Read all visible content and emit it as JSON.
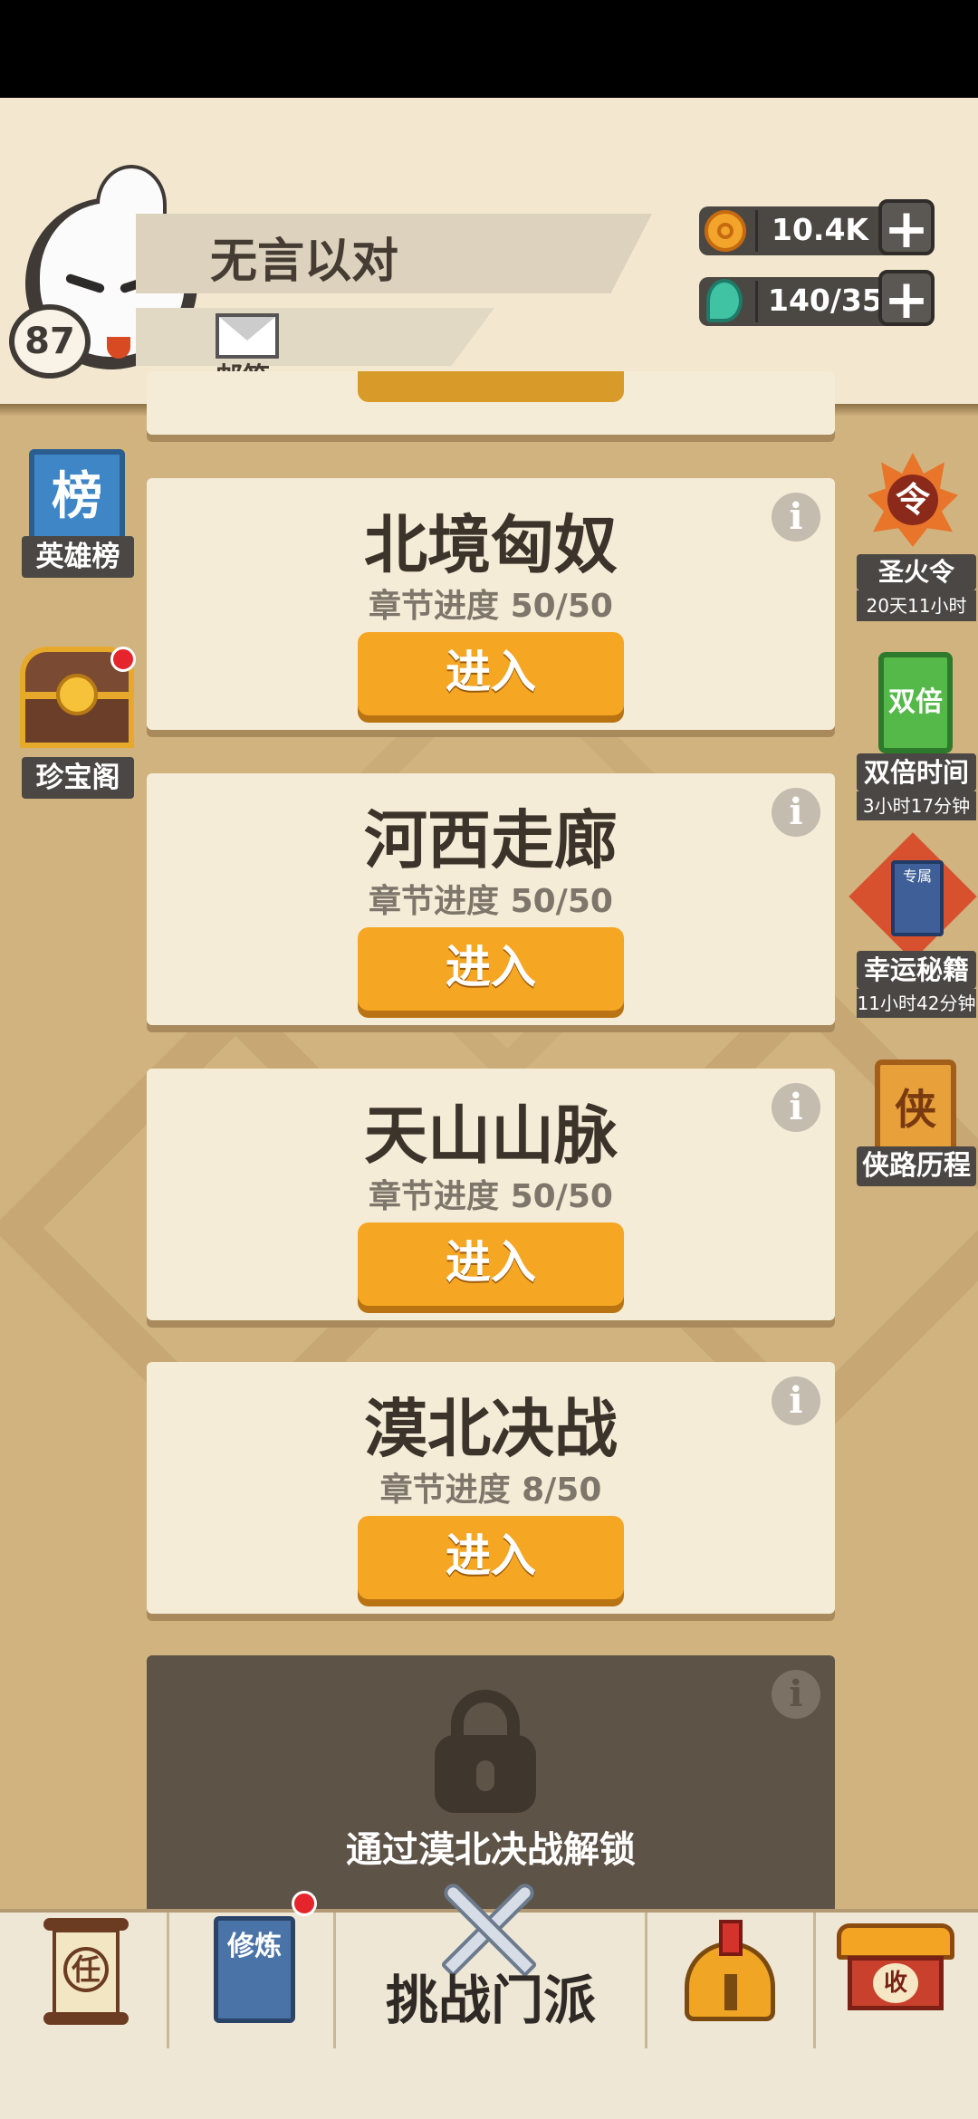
{
  "player": {
    "name": "无言以对",
    "level": "87",
    "mail_label": "邮箱"
  },
  "resources": {
    "coins": "10.4K",
    "energy": "140/35"
  },
  "left_menu": {
    "rank_icon_char": "榜",
    "rank_label": "英雄榜",
    "treasure_label": "珍宝阁"
  },
  "right_menu": {
    "fire_icon_char": "令",
    "fire_label": "圣火令",
    "fire_timer": "20天11小时",
    "double_icon_text": "双倍",
    "double_label": "双倍时间",
    "double_timer": "3小时17分钟",
    "lucky_book_text": "专属",
    "lucky_label": "幸运秘籍",
    "lucky_timer": "11小时42分钟",
    "hero_icon_char": "侠",
    "hero_label": "侠路历程"
  },
  "chapters": [
    {
      "title": "北境匈奴",
      "progress": "章节进度 50/50",
      "button": "进入"
    },
    {
      "title": "河西走廊",
      "progress": "章节进度 50/50",
      "button": "进入"
    },
    {
      "title": "天山山脉",
      "progress": "章节进度 50/50",
      "button": "进入"
    },
    {
      "title": "漠北决战",
      "progress": "章节进度 8/50",
      "button": "进入"
    }
  ],
  "locked_chapter": {
    "unlock_text": "通过漠北决战解锁"
  },
  "info_glyph": "i",
  "bottom_nav": {
    "task_char": "任",
    "train_text": "修炼",
    "challenge_label": "挑战门派",
    "shop_char": "收"
  }
}
